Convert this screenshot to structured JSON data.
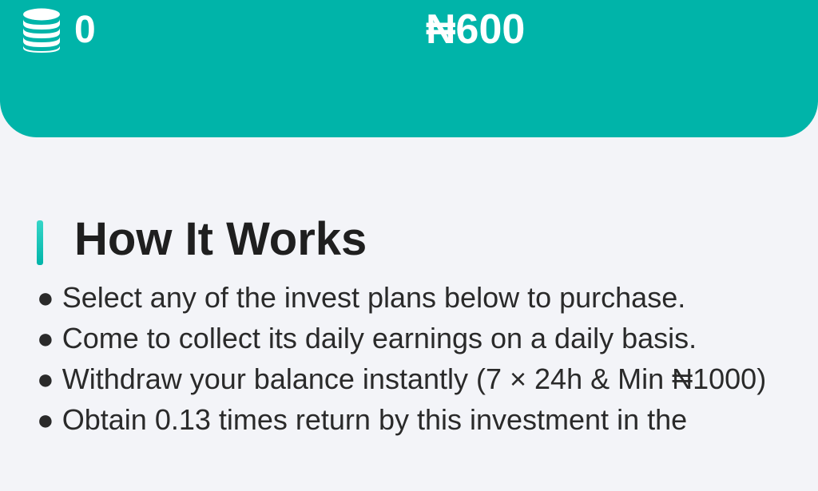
{
  "header": {
    "coin_icon": "coins-stack-icon",
    "coin_count": "0",
    "balance": "₦600"
  },
  "how_it_works": {
    "title": "How It Works",
    "steps": [
      "● Select any of the invest plans below to purchase.",
      "● Come to collect its daily earnings on a daily basis.",
      "● Withdraw your balance instantly (7 × 24h & Min ₦1000)",
      "● Obtain 0.13 times return by this investment in the"
    ]
  },
  "colors": {
    "accent": "#00b4a9",
    "background": "#f3f4f8",
    "text": "#2a2a2a"
  }
}
